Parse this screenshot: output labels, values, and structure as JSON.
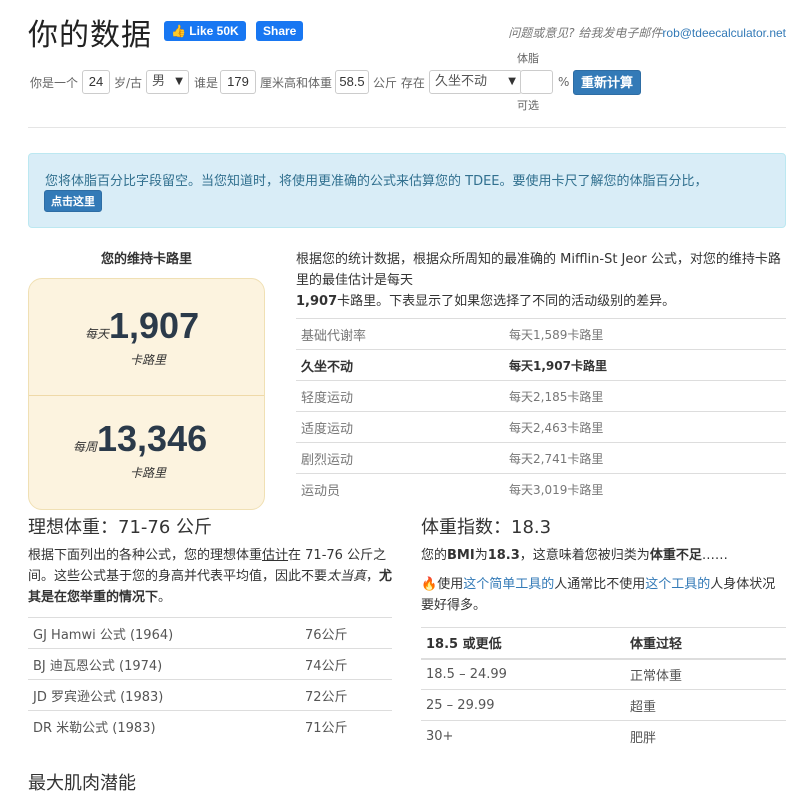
{
  "header": {
    "title": "你的数据",
    "fb_like": "Like 50K",
    "fb_share": "Share",
    "feedback_prefix": "问题或意见? 给我发电子邮件",
    "feedback_email": "rob@tdeecalculator.net"
  },
  "form": {
    "you_are": "你是一个",
    "age": "24",
    "age_suffix": "岁/古",
    "gender": "男",
    "who_is": "谁是",
    "height": "179",
    "height_unit": "厘米高和体重",
    "weight": "58.5",
    "weight_unit": "公斤 存在",
    "activity": "久坐不动",
    "bodyfat_label": "体脂",
    "bodyfat_value": "",
    "bodyfat_optional": "可选",
    "percent": "%",
    "recalc_button": "重新计算"
  },
  "alert": {
    "text": "您将体脂百分比字段留空。当您知道时，将使用更准确的公式来估算您的 TDEE。要使用卡尺了解您的体脂百分比，",
    "button": "点击这里"
  },
  "maintenance": {
    "heading": "您的维持卡路里",
    "daily_prefix": "每天",
    "daily_value": "1,907",
    "daily_unit": "卡路里",
    "weekly_prefix": "每周",
    "weekly_value": "13,346",
    "weekly_unit": "卡路里"
  },
  "intro": {
    "text1": "根据您的统计数据，根据众所周知的最准确的 Mifflin-St Jeor 公式，对您的维持卡路里的最佳估计是每天",
    "bold": "1,907",
    "text2": "卡路里。下表显示了如果您选择了不同的活动级别的差异。"
  },
  "activity_rows": [
    {
      "label": "基础代谢率",
      "value": "每天1,589卡路里"
    },
    {
      "label": "久坐不动",
      "value": "每天1,907卡路里"
    },
    {
      "label": "轻度运动",
      "value": "每天2,185卡路里"
    },
    {
      "label": "适度运动",
      "value": "每天2,463卡路里"
    },
    {
      "label": "剧烈运动",
      "value": "每天2,741卡路里"
    },
    {
      "label": "运动员",
      "value": "每天3,019卡路里"
    }
  ],
  "ideal_weight": {
    "heading": "理想体重：71-76 公斤",
    "desc1": "根据下面列出的各种公式，您的理想体重",
    "desc_underline": "估计",
    "desc2": "在 71-76 公斤之间。这些公式基于您的身高并代表平均值，因此不要",
    "desc_italic": "太当真",
    "desc3": "，",
    "desc_bold": "尤其是在您举重的情况下",
    "desc4": "。",
    "formulas": [
      {
        "name": "GJ Hamwi 公式 (1964)",
        "value": "76公斤"
      },
      {
        "name": "BJ 迪瓦恩公式 (1974)",
        "value": "74公斤"
      },
      {
        "name": "JD 罗宾逊公式 (1983)",
        "value": "72公斤"
      },
      {
        "name": "DR 米勒公式 (1983)",
        "value": "71公斤"
      }
    ]
  },
  "bmi": {
    "heading": "体重指数：18.3",
    "desc1": "您的",
    "desc_bmi": "BMI",
    "desc2": "为",
    "desc_value": "18.3",
    "desc3": "，这意味着您被归类为",
    "desc_class": "体重不足",
    "desc4": "……",
    "tool1": "使用",
    "tool_link1": "这个简单工具的",
    "tool2": "人通常比不使用",
    "tool_link2": "这个工具的",
    "tool3": "人身体状况要好得多。",
    "table_header": [
      "18.5 或更低",
      "体重过轻"
    ],
    "rows": [
      [
        "18.5 – 24.99",
        "正常体重"
      ],
      [
        "25 – 29.99",
        "超重"
      ],
      [
        "30+",
        "肥胖"
      ]
    ]
  },
  "muscle": {
    "heading": "最大肌肉潜能"
  }
}
